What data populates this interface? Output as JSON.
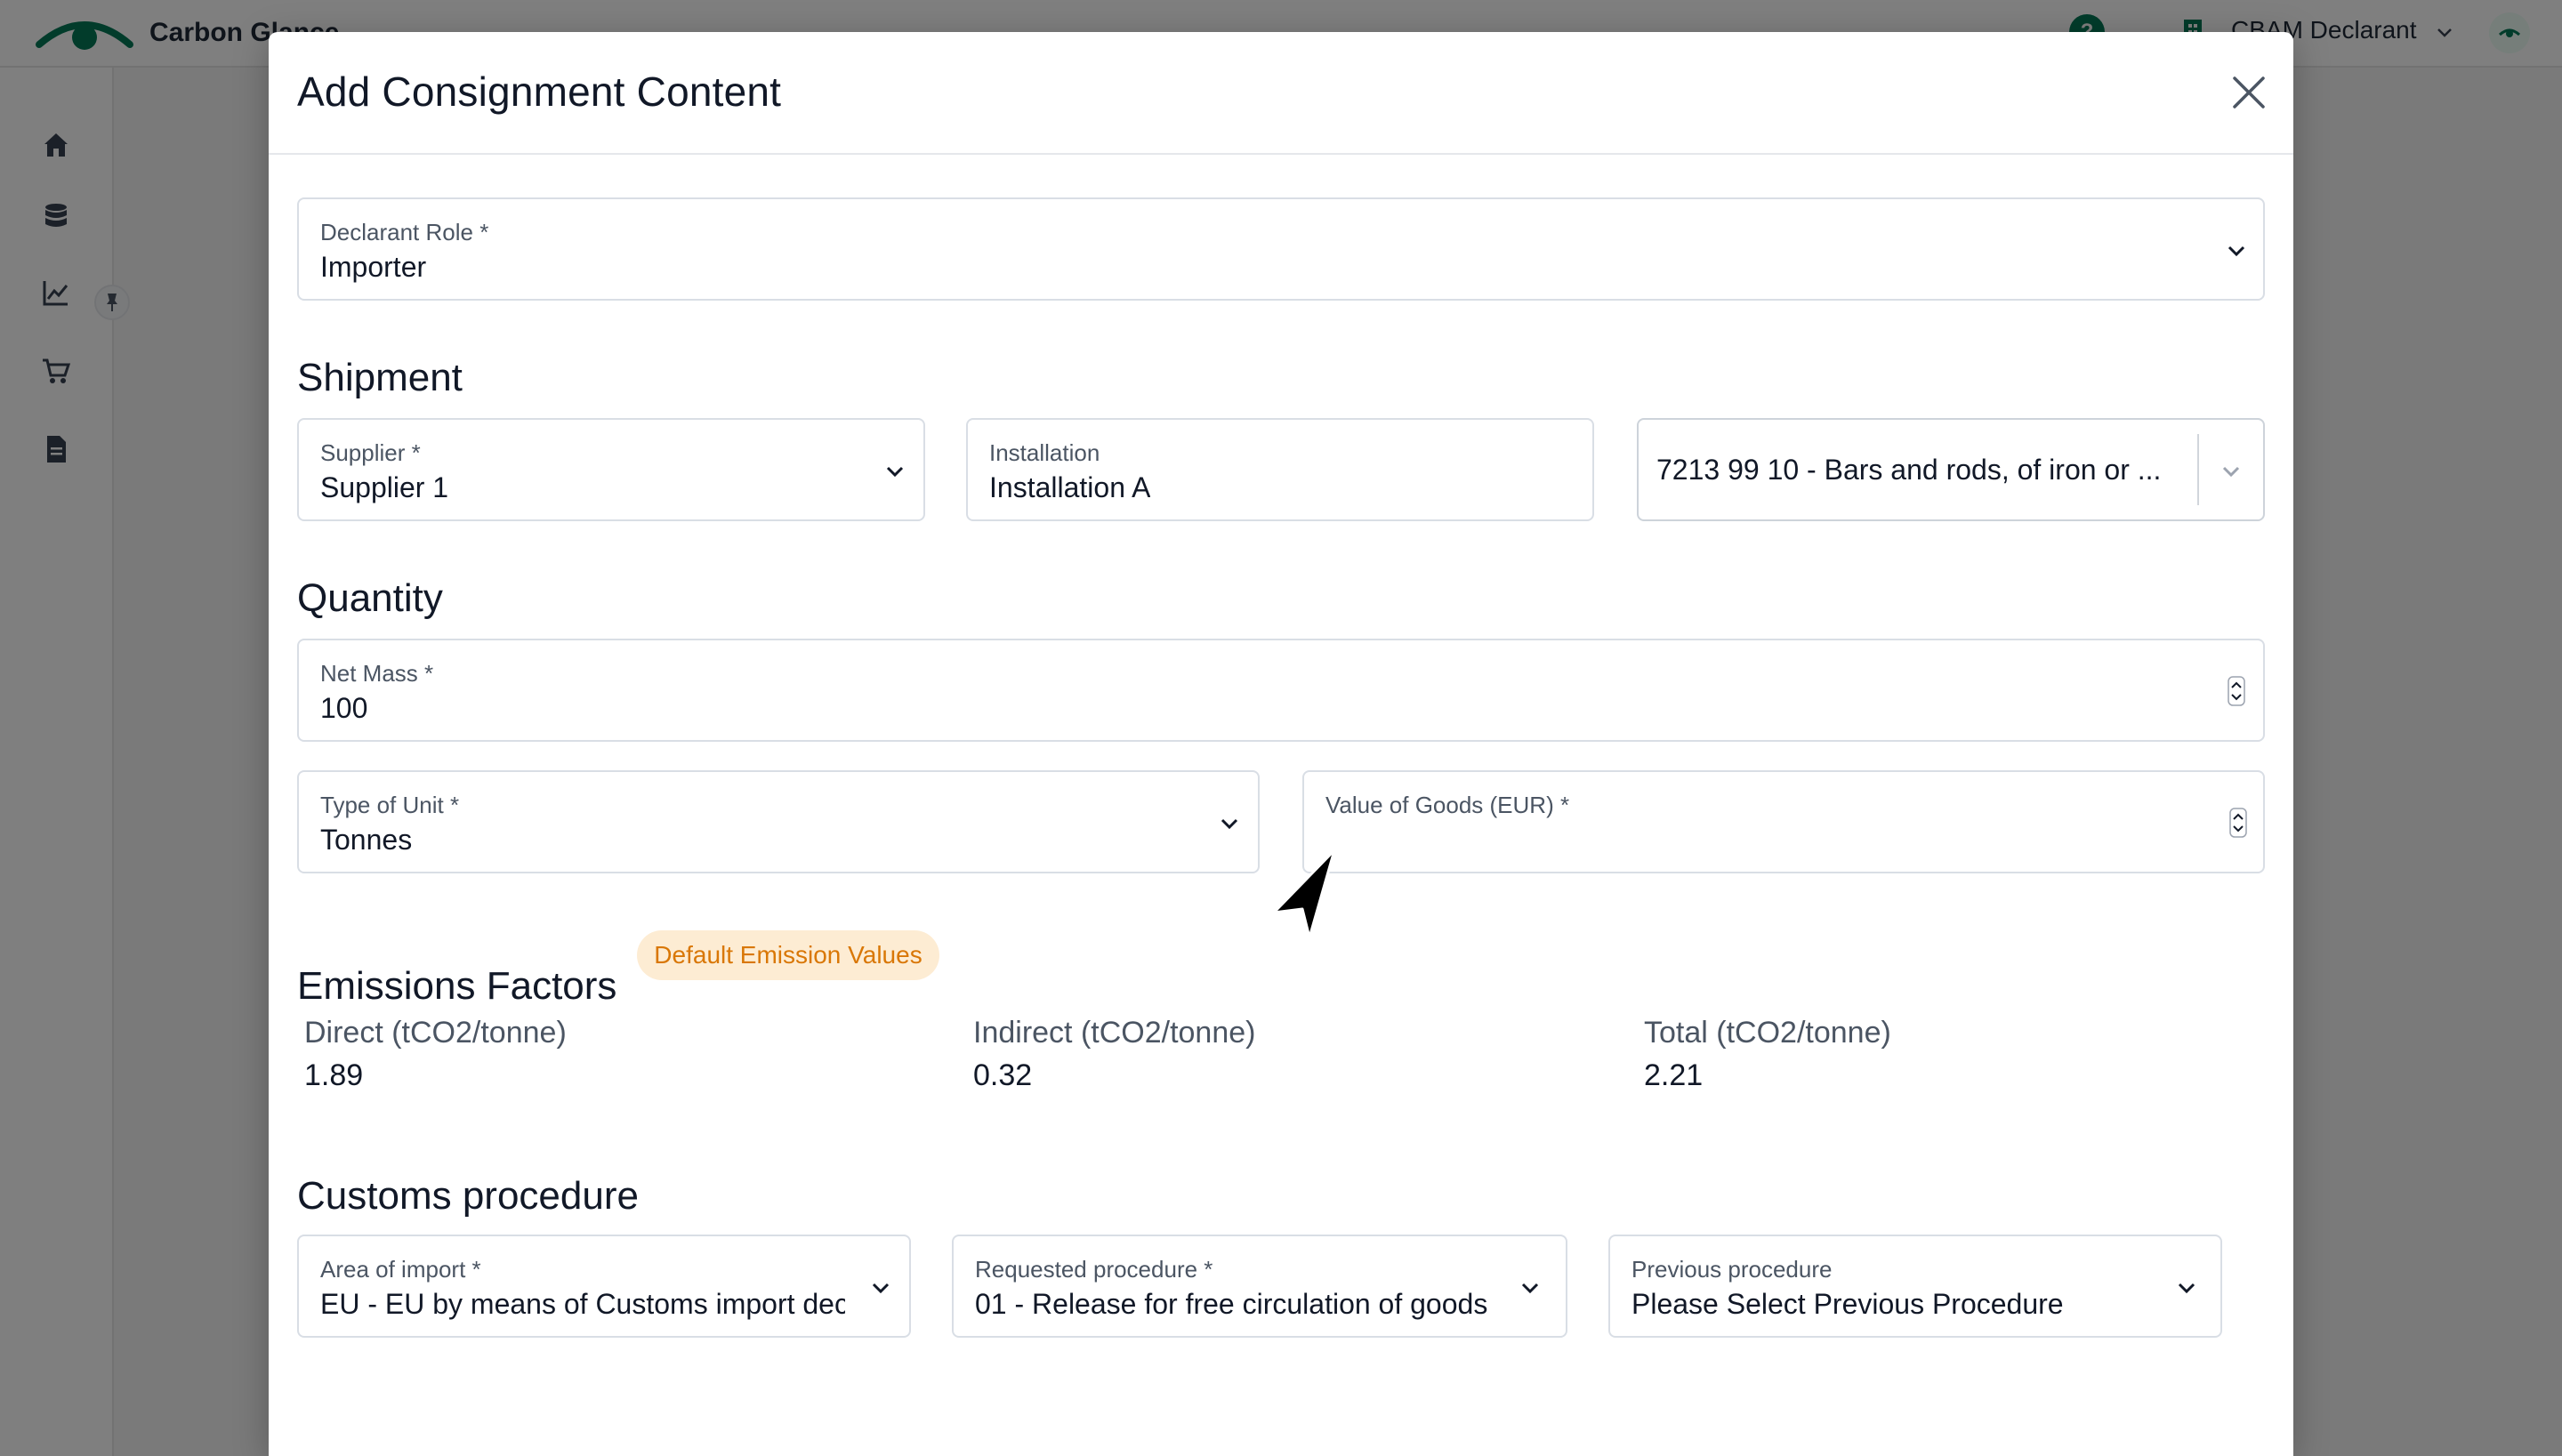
{
  "app": {
    "brand": "Carbon Glance",
    "user_menu": "CBAM Declarant",
    "help_symbol": "?",
    "colors": {
      "brand": "#047857",
      "badge_bg": "#fdecd3",
      "badge_text": "#d97706"
    },
    "sidebar_icons": [
      "home-icon",
      "database-icon",
      "chart-line-icon",
      "cart-icon",
      "document-icon"
    ]
  },
  "modal": {
    "title": "Add Consignment Content",
    "declarant_role": {
      "label": "Declarant Role *",
      "value": "Importer"
    },
    "shipment": {
      "title": "Shipment",
      "supplier": {
        "label": "Supplier *",
        "value": "Supplier 1"
      },
      "installation": {
        "label": "Installation",
        "value": "Installation A"
      },
      "cn_code": {
        "value": "7213 99 10 - Bars and rods, of iron or ..."
      }
    },
    "quantity": {
      "title": "Quantity",
      "net_mass": {
        "label": "Net Mass *",
        "value": "100"
      },
      "unit_type": {
        "label": "Type of Unit *",
        "value": "Tonnes"
      },
      "goods_value": {
        "label": "Value of Goods (EUR) *",
        "value": ""
      }
    },
    "emissions": {
      "title": "Emissions Factors",
      "badge": "Default Emission Values",
      "direct": {
        "label": "Direct (tCO2/tonne)",
        "value": "1.89"
      },
      "indirect": {
        "label": "Indirect (tCO2/tonne)",
        "value": "0.32"
      },
      "total": {
        "label": "Total (tCO2/tonne)",
        "value": "2.21"
      }
    },
    "customs": {
      "title": "Customs procedure",
      "area_of_import": {
        "label": "Area of import *",
        "value": "EU - EU by means of Customs import declaration"
      },
      "requested_procedure": {
        "label": "Requested procedure *",
        "value": "01 - Release for free circulation of goods"
      },
      "previous_procedure": {
        "label": "Previous procedure",
        "value": "Please Select Previous Procedure"
      }
    }
  }
}
